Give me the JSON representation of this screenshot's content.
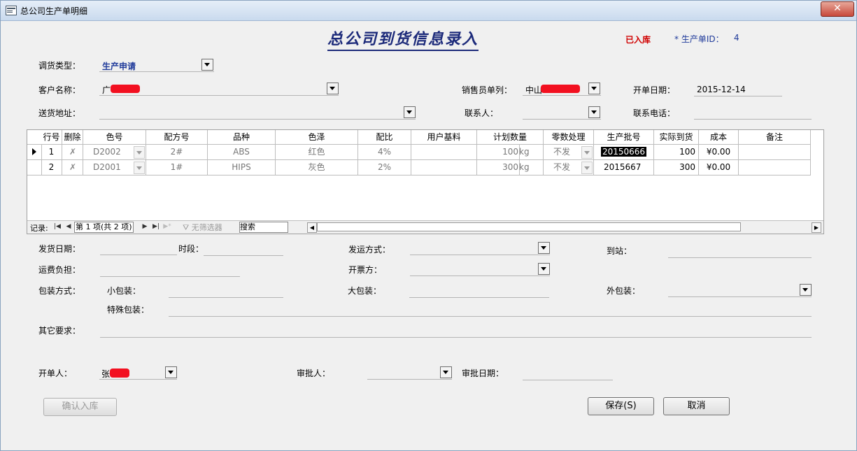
{
  "window": {
    "title": "总公司生产单明细",
    "close": "✕"
  },
  "header": {
    "heading": "总公司到货信息录入",
    "status": "已入库",
    "id_label": "* 生产单ID：",
    "id_value": "4"
  },
  "form": {
    "transfer_type_label": "调货类型：",
    "transfer_type": "生产申请",
    "customer_label": "客户名称：",
    "customer_value": "广",
    "salesperson_label": "销售员单列：",
    "salesperson_value": "中山",
    "open_date_label": "开单日期：",
    "open_date": "2015-12-14",
    "address_label": "送货地址：",
    "address_value": "",
    "contact_label": "联系人：",
    "contact_value": "",
    "phone_label": "联系电话：",
    "phone_value": ""
  },
  "grid": {
    "columns": [
      "行号",
      "删除",
      "色号",
      "配方号",
      "品种",
      "色泽",
      "配比",
      "用户基料",
      "计划数量",
      "零数处理",
      "生产批号",
      "实际到货",
      "成本",
      "备注"
    ],
    "rows": [
      {
        "no": "1",
        "color_no": "D2002",
        "formula": "2#",
        "variety": "ABS",
        "shade": "红色",
        "ratio": "4%",
        "base": "",
        "qty": "100",
        "unit": "kg",
        "remainder": "不发",
        "batch": "20150666",
        "actual": "100",
        "cost": "¥0.00",
        "note": ""
      },
      {
        "no": "2",
        "color_no": "D2001",
        "formula": "1#",
        "variety": "HIPS",
        "shade": "灰色",
        "ratio": "2%",
        "base": "",
        "qty": "300",
        "unit": "kg",
        "remainder": "不发",
        "batch": "2015667",
        "actual": "300",
        "cost": "¥0.00",
        "note": ""
      }
    ],
    "nav": {
      "records_label": "记录:",
      "position": "第 1 项(共 2 项)",
      "filter": "无筛选器",
      "search": "搜索"
    }
  },
  "shipping": {
    "ship_date_label": "发货日期：",
    "period_label": "时段：",
    "method_label": "发运方式：",
    "station_label": "到站：",
    "freight_label": "运费负担：",
    "invoice_label": "开票方：",
    "packing_label": "包装方式：",
    "small_pack_label": "小包装：",
    "big_pack_label": "大包装：",
    "outer_pack_label": "外包装：",
    "special_pack_label": "特殊包装：",
    "other_req_label": "其它要求："
  },
  "footer": {
    "creator_label": "开单人：",
    "creator_value": "张",
    "approver_label": "审批人：",
    "approve_date_label": "审批日期：",
    "confirm_button": "确认入库",
    "save_button": "保存(S)",
    "cancel_button": "取消"
  }
}
